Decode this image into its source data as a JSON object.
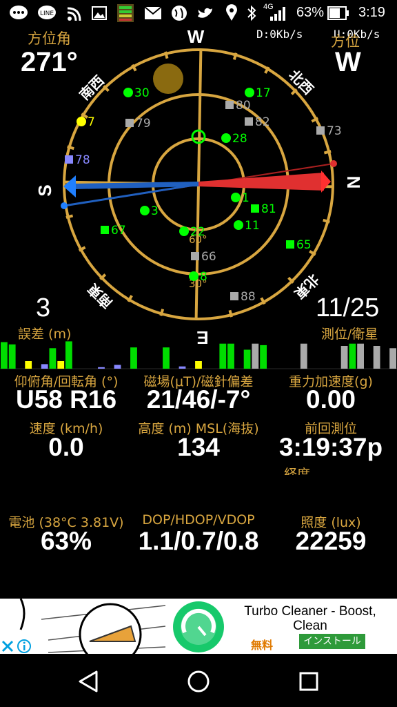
{
  "status_bar": {
    "carrier_icons": [
      "message-icon",
      "line-icon",
      "wifi-icon",
      "image-icon",
      "signal-app-icon",
      "gmail-icon",
      "globe-icon",
      "twitter-icon",
      "location-icon",
      "bluetooth-icon"
    ],
    "network": "4G",
    "battery": "63%",
    "time": "3:19"
  },
  "header": {
    "azimuth_label": "方位角",
    "azimuth_value": "271°",
    "speed_down": "D:0Kb/s",
    "speed_up": "U:0Kb/s",
    "heading_label": "方位",
    "heading_value": "W"
  },
  "compass": {
    "north": "N",
    "south": "S",
    "east": "E",
    "west": "W",
    "nw": "北西",
    "sw": "南西",
    "se": "南東",
    "ne": "北東",
    "ring_60": "60°",
    "ring_30": "30°",
    "satellites": [
      {
        "id": "30",
        "type": "gps",
        "color": "#00ff00"
      },
      {
        "id": "17",
        "type": "gps",
        "color": "#00ff00"
      },
      {
        "id": "80",
        "type": "other",
        "color": "#aaaaaa"
      },
      {
        "id": "82",
        "type": "other",
        "color": "#aaaaaa"
      },
      {
        "id": "79",
        "type": "other",
        "color": "#aaaaaa"
      },
      {
        "id": "73",
        "type": "other",
        "color": "#aaaaaa"
      },
      {
        "id": "28",
        "type": "gps",
        "color": "#00ff00"
      },
      {
        "id": "7",
        "type": "gps",
        "color": "#ffff00"
      },
      {
        "id": "78",
        "type": "other",
        "color": "#8888ff"
      },
      {
        "id": "1",
        "type": "gps",
        "color": "#00ff00"
      },
      {
        "id": "81",
        "type": "glonass",
        "color": "#00ff00"
      },
      {
        "id": "3",
        "type": "gps",
        "color": "#00ff00"
      },
      {
        "id": "67",
        "type": "glonass",
        "color": "#00ff00"
      },
      {
        "id": "11",
        "type": "gps",
        "color": "#00ff00"
      },
      {
        "id": "22",
        "type": "gps",
        "color": "#00ff00"
      },
      {
        "id": "65",
        "type": "glonass",
        "color": "#00ff00"
      },
      {
        "id": "66",
        "type": "other",
        "color": "#aaaaaa"
      },
      {
        "id": "8",
        "type": "gps",
        "color": "#00ff00"
      },
      {
        "id": "88",
        "type": "other",
        "color": "#aaaaaa"
      }
    ]
  },
  "error": {
    "value": "3",
    "label": "誤差 (m)"
  },
  "fix": {
    "value": "11/25",
    "label": "測位/衛星"
  },
  "grid": {
    "pitch_label": "仰俯角/回転角 (°)",
    "pitch_value": "U58 R16",
    "mag_label": "磁場(μT)/磁針偏差",
    "mag_value": "21/46/-7°",
    "grav_label": "重力加速度(g)",
    "grav_value": "0.00",
    "speed_label": "速度 (km/h)",
    "speed_value": "0.0",
    "alt_label": "高度 (m) MSL(海抜)",
    "alt_value": "134",
    "last_label": "前回測位",
    "last_value": "3:19:37p",
    "lon_label": "経度",
    "battery_label": "電池 (38°C 3.81V)",
    "battery_value": "63%",
    "dop_label": "DOP/HDOP/VDOP",
    "dop_value": "1.1/0.7/0.8",
    "lux_label": "照度 (lux)",
    "lux_value": "22259"
  },
  "ad": {
    "title": "Turbo Cleaner - Boost, Clean",
    "free": "無料",
    "install": "インストール"
  },
  "signal_bars": {
    "values": [
      0.35,
      0.32,
      0,
      0.1,
      0,
      0.06,
      0.27,
      0.1,
      0.36,
      0,
      0,
      0,
      0.02,
      0,
      0.05,
      0,
      0.28,
      0,
      0,
      0,
      0.28,
      0,
      0.03,
      0,
      0.1,
      0,
      0,
      0.33,
      0.33,
      0,
      0.25,
      0.33,
      0.31,
      0,
      0,
      0,
      0,
      0.33,
      0,
      0,
      0,
      0,
      0.3,
      0.33,
      0.33,
      0,
      0.3,
      0,
      0.27
    ],
    "colors": [
      "#00dd00",
      "#00dd00",
      "#000",
      "#ffff00",
      "#000",
      "#8888ff",
      "#00dd00",
      "#ffff00",
      "#00dd00",
      "#000",
      "#000",
      "#000",
      "#8888ff",
      "#000",
      "#8888ff",
      "#000",
      "#00dd00",
      "#000",
      "#000",
      "#000",
      "#00dd00",
      "#000",
      "#8888ff",
      "#000",
      "#ffff00",
      "#000",
      "#000",
      "#00dd00",
      "#00dd00",
      "#000",
      "#00dd00",
      "#aaaaaa",
      "#00dd00",
      "#000",
      "#000",
      "#000",
      "#000",
      "#aaaaaa",
      "#000",
      "#000",
      "#000",
      "#000",
      "#aaaaaa",
      "#00dd00",
      "#aaaaaa",
      "#000",
      "#aaaaaa",
      "#000",
      "#aaaaaa"
    ]
  }
}
